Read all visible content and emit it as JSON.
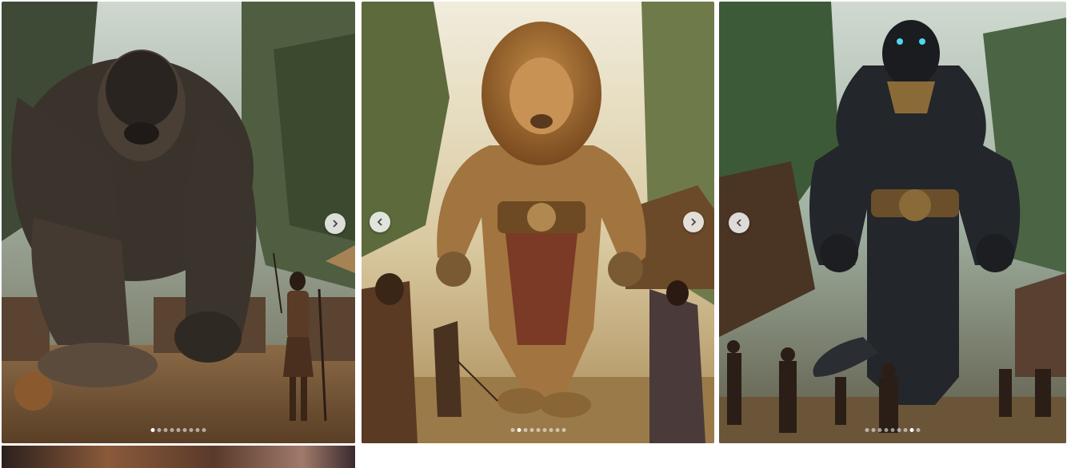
{
  "posts": [
    {
      "id_label": "gorilla",
      "active_dot": 0,
      "dot_count": 9,
      "nav": [
        "next"
      ]
    },
    {
      "id_label": "lion",
      "active_dot": 1,
      "dot_count": 9,
      "nav": [
        "prev",
        "next"
      ]
    },
    {
      "id_label": "panther",
      "active_dot": 7,
      "dot_count": 9,
      "nav": [
        "prev"
      ]
    }
  ],
  "icons": {
    "next": "chevron-right-icon",
    "prev": "chevron-left-icon"
  },
  "colors": {
    "button_bg": "#ffffff",
    "dot_active": "#ffffff",
    "dot_inactive": "#bfbfbf"
  }
}
